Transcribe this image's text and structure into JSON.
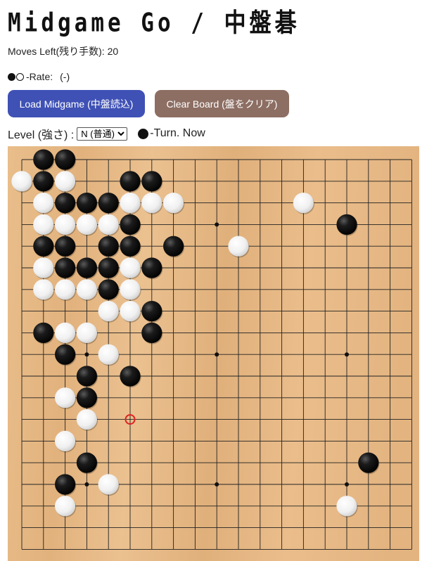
{
  "title": "Midgame Go / 中盤碁",
  "moves_left_text": "Moves Left(残り手数): 20",
  "rate": {
    "label": "-Rate:",
    "value": "(-)"
  },
  "buttons": {
    "load_label": "Load Midgame (中盤読込)",
    "clear_label": "Clear Board (盤をクリア)"
  },
  "level": {
    "label": "Level (強さ) :",
    "selected": "N (普通)",
    "options": [
      "N (普通)"
    ]
  },
  "turn_text": "-Turn. Now",
  "colors": {
    "board": "#e6b985",
    "grid": "#222222",
    "load_button": "#3f51b5",
    "clear_button": "#8d6e63",
    "last_move_marker": "#dd2222"
  },
  "board": {
    "size": 19,
    "hoshi": [
      [
        3,
        3
      ],
      [
        9,
        3
      ],
      [
        15,
        3
      ],
      [
        3,
        9
      ],
      [
        9,
        9
      ],
      [
        15,
        9
      ],
      [
        3,
        15
      ],
      [
        9,
        15
      ],
      [
        15,
        15
      ]
    ],
    "last_move": [
      5,
      12
    ],
    "stones": [
      {
        "c": "b",
        "x": 1,
        "y": 0
      },
      {
        "c": "b",
        "x": 2,
        "y": 0
      },
      {
        "c": "w",
        "x": 0,
        "y": 1
      },
      {
        "c": "b",
        "x": 1,
        "y": 1
      },
      {
        "c": "w",
        "x": 2,
        "y": 1
      },
      {
        "c": "b",
        "x": 5,
        "y": 1
      },
      {
        "c": "b",
        "x": 6,
        "y": 1
      },
      {
        "c": "w",
        "x": 1,
        "y": 2
      },
      {
        "c": "b",
        "x": 2,
        "y": 2
      },
      {
        "c": "b",
        "x": 3,
        "y": 2
      },
      {
        "c": "b",
        "x": 4,
        "y": 2
      },
      {
        "c": "w",
        "x": 5,
        "y": 2
      },
      {
        "c": "w",
        "x": 6,
        "y": 2
      },
      {
        "c": "w",
        "x": 7,
        "y": 2
      },
      {
        "c": "w",
        "x": 13,
        "y": 2
      },
      {
        "c": "w",
        "x": 1,
        "y": 3
      },
      {
        "c": "w",
        "x": 2,
        "y": 3
      },
      {
        "c": "w",
        "x": 3,
        "y": 3
      },
      {
        "c": "w",
        "x": 4,
        "y": 3
      },
      {
        "c": "b",
        "x": 5,
        "y": 3
      },
      {
        "c": "b",
        "x": 15,
        "y": 3
      },
      {
        "c": "b",
        "x": 1,
        "y": 4
      },
      {
        "c": "b",
        "x": 2,
        "y": 4
      },
      {
        "c": "b",
        "x": 4,
        "y": 4
      },
      {
        "c": "b",
        "x": 5,
        "y": 4
      },
      {
        "c": "b",
        "x": 7,
        "y": 4
      },
      {
        "c": "w",
        "x": 10,
        "y": 4
      },
      {
        "c": "w",
        "x": 1,
        "y": 5
      },
      {
        "c": "b",
        "x": 2,
        "y": 5
      },
      {
        "c": "b",
        "x": 3,
        "y": 5
      },
      {
        "c": "b",
        "x": 4,
        "y": 5
      },
      {
        "c": "w",
        "x": 5,
        "y": 5
      },
      {
        "c": "b",
        "x": 6,
        "y": 5
      },
      {
        "c": "w",
        "x": 1,
        "y": 6
      },
      {
        "c": "w",
        "x": 2,
        "y": 6
      },
      {
        "c": "w",
        "x": 3,
        "y": 6
      },
      {
        "c": "b",
        "x": 4,
        "y": 6
      },
      {
        "c": "w",
        "x": 5,
        "y": 6
      },
      {
        "c": "w",
        "x": 4,
        "y": 7
      },
      {
        "c": "w",
        "x": 5,
        "y": 7
      },
      {
        "c": "b",
        "x": 6,
        "y": 7
      },
      {
        "c": "b",
        "x": 1,
        "y": 8
      },
      {
        "c": "w",
        "x": 2,
        "y": 8
      },
      {
        "c": "w",
        "x": 3,
        "y": 8
      },
      {
        "c": "b",
        "x": 6,
        "y": 8
      },
      {
        "c": "b",
        "x": 2,
        "y": 9
      },
      {
        "c": "w",
        "x": 4,
        "y": 9
      },
      {
        "c": "b",
        "x": 3,
        "y": 10
      },
      {
        "c": "b",
        "x": 5,
        "y": 10
      },
      {
        "c": "w",
        "x": 2,
        "y": 11
      },
      {
        "c": "b",
        "x": 3,
        "y": 11
      },
      {
        "c": "w",
        "x": 3,
        "y": 12
      },
      {
        "c": "w",
        "x": 2,
        "y": 13
      },
      {
        "c": "b",
        "x": 3,
        "y": 14
      },
      {
        "c": "b",
        "x": 16,
        "y": 14
      },
      {
        "c": "b",
        "x": 2,
        "y": 15
      },
      {
        "c": "w",
        "x": 4,
        "y": 15
      },
      {
        "c": "w",
        "x": 2,
        "y": 16
      },
      {
        "c": "w",
        "x": 15,
        "y": 16
      }
    ]
  }
}
